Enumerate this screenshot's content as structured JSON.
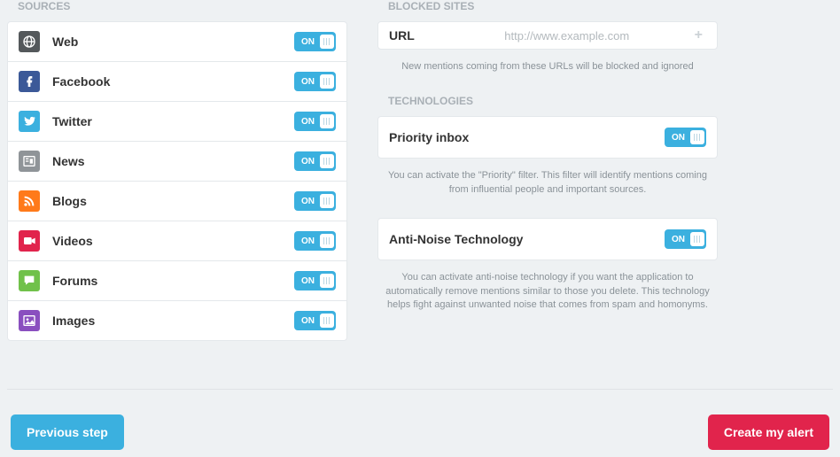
{
  "toggle": {
    "on": "ON"
  },
  "sources": {
    "title": "SOURCES",
    "items": [
      {
        "label": "Web",
        "name": "web",
        "icon": "globe",
        "bg": "#54585b"
      },
      {
        "label": "Facebook",
        "name": "facebook",
        "icon": "fb",
        "bg": "#3b5998"
      },
      {
        "label": "Twitter",
        "name": "twitter",
        "icon": "tw",
        "bg": "#3bb0df"
      },
      {
        "label": "News",
        "name": "news",
        "icon": "news",
        "bg": "#8f9498"
      },
      {
        "label": "Blogs",
        "name": "blogs",
        "icon": "rss",
        "bg": "#ff7a1a"
      },
      {
        "label": "Videos",
        "name": "videos",
        "icon": "video",
        "bg": "#e1244c"
      },
      {
        "label": "Forums",
        "name": "forums",
        "icon": "chat",
        "bg": "#70c14a"
      },
      {
        "label": "Images",
        "name": "images",
        "icon": "image",
        "bg": "#8a4fbf"
      }
    ]
  },
  "blocked": {
    "title": "BLOCKED SITES",
    "url_label": "URL",
    "url_placeholder": "http://www.example.com",
    "help": "New mentions coming from these URLs will be blocked and ignored"
  },
  "technologies": {
    "title": "TECHNOLOGIES",
    "priority": {
      "label": "Priority inbox",
      "help": "You can activate the \"Priority\" filter. This filter will identify mentions coming from influential people and important sources."
    },
    "antinoise": {
      "label": "Anti-Noise Technology",
      "help": "You can activate anti-noise technology if you want the application to automatically remove mentions similar to those you delete. This technology helps fight against unwanted noise that comes from spam and homonyms."
    }
  },
  "footer": {
    "prev": "Previous step",
    "create": "Create my alert"
  }
}
